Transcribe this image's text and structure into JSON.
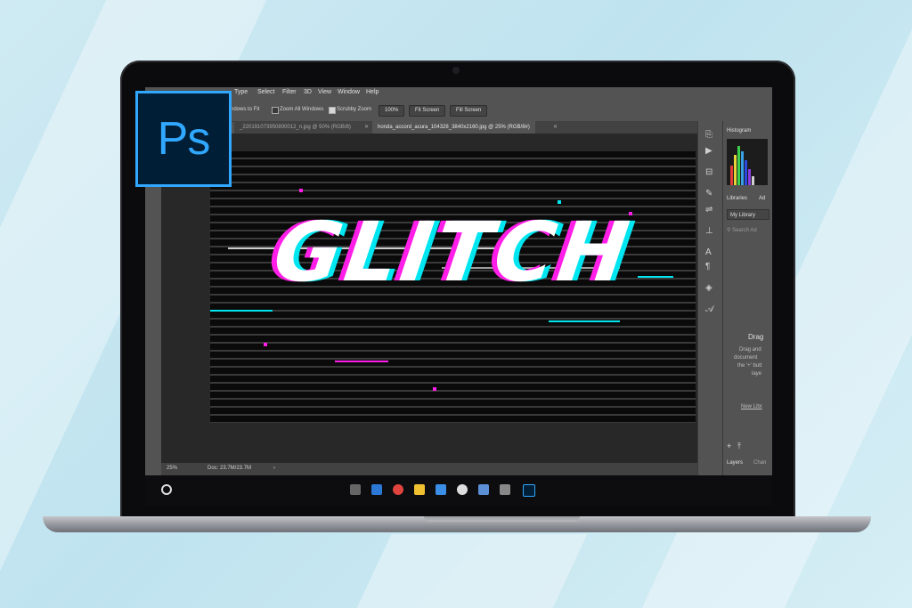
{
  "colors": {
    "background": "#cfeaf3",
    "ps_blue": "#31a8ff",
    "ps_navy": "#001e36",
    "glitch_magenta": "#ff1ee8",
    "glitch_cyan": "#00e6f0",
    "ui_gray": "#535353"
  },
  "logo": {
    "text": "Ps"
  },
  "menubar": {
    "items": [
      "Type",
      "Select",
      "Filter",
      "3D",
      "View",
      "Window",
      "Help"
    ]
  },
  "options_bar": {
    "windows_to_fit": "ndows to Fit",
    "zoom_all_windows": "Zoom All Windows",
    "scrubby_zoom": "Scrubby Zoom",
    "zoom_value": "100%",
    "fit_screen": "Fit Screen",
    "fill_screen": "Fill Screen"
  },
  "tabs": [
    {
      "label": "_220191073950800012_n.jpg @ 50% (RGB/8)",
      "active": false
    },
    {
      "label": "honda_accord_acura_104328_3840x2160.jpg @ 25% (RGB/8#)",
      "active": true
    }
  ],
  "canvas": {
    "headline": "GLITCH"
  },
  "status": {
    "zoom": "25%",
    "doc": "Doc: 23.7M/23.7M"
  },
  "right_panel": {
    "histogram_tab": "Histogram",
    "libraries_tab": "Libraries",
    "adjust_tab": "Ad",
    "library_select": "My Library",
    "search_placeholder": "Search Ad",
    "drag_title": "Drag",
    "drag_line1": "Drag and",
    "drag_line2": "document",
    "drag_line3": "the '+' butt",
    "drag_line4": "laye",
    "new_library": "New Libr",
    "layers_tab": "Layers",
    "channels_tab": "Chan"
  },
  "icons": {
    "strip": [
      "history-icon",
      "play-icon",
      "properties-icon",
      "brush-icon",
      "adjust-icon",
      "stamp-icon",
      "character-icon",
      "paragraph-icon",
      "3d-icon",
      "glyphs-icon"
    ]
  }
}
